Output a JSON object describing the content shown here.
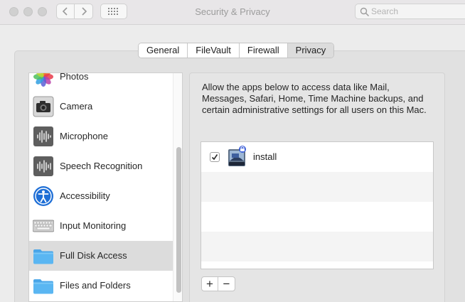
{
  "window": {
    "title": "Security & Privacy",
    "search_placeholder": "Search"
  },
  "tabs": [
    {
      "label": "General",
      "selected": false
    },
    {
      "label": "FileVault",
      "selected": false
    },
    {
      "label": "Firewall",
      "selected": false
    },
    {
      "label": "Privacy",
      "selected": true
    }
  ],
  "sidebar": {
    "items": [
      {
        "label": "Photos",
        "icon": "photos-icon",
        "selected": false
      },
      {
        "label": "Camera",
        "icon": "camera-icon",
        "selected": false
      },
      {
        "label": "Microphone",
        "icon": "microphone-icon",
        "selected": false
      },
      {
        "label": "Speech Recognition",
        "icon": "speech-recognition-icon",
        "selected": false
      },
      {
        "label": "Accessibility",
        "icon": "accessibility-icon",
        "selected": false
      },
      {
        "label": "Input Monitoring",
        "icon": "keyboard-icon",
        "selected": false
      },
      {
        "label": "Full Disk Access",
        "icon": "folder-icon",
        "selected": true
      },
      {
        "label": "Files and Folders",
        "icon": "folder-icon",
        "selected": false
      }
    ]
  },
  "privacy": {
    "description": "Allow the apps below to access data like Mail, Messages, Safari, Home, Time Machine backups, and certain administrative settings for all users on this Mac.",
    "apps": [
      {
        "name": "install",
        "checked": true,
        "icon": "installer-icon"
      }
    ],
    "add_label": "+",
    "remove_label": "−"
  },
  "colors": {
    "selected_row": "#dcdcdc",
    "folder_blue": "#5ab6f2",
    "accessibility_blue": "#1f6fd6"
  }
}
